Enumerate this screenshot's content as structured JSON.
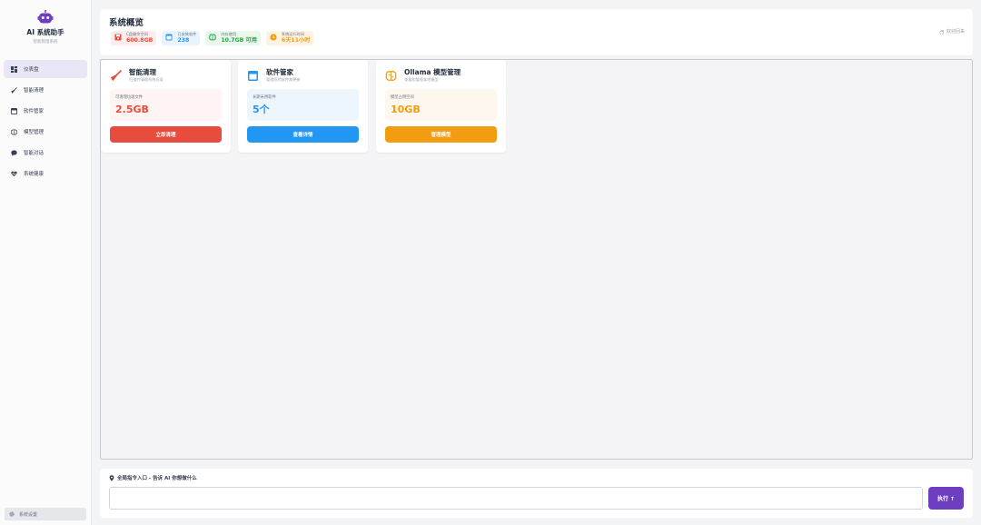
{
  "brand": {
    "title": "AI 系统助手",
    "subtitle": "智能管理系统"
  },
  "sidebar": {
    "items": [
      {
        "label": "仪表盘",
        "icon": "dashboard-icon",
        "active": true
      },
      {
        "label": "智能清理",
        "icon": "broom-icon",
        "active": false
      },
      {
        "label": "软件管家",
        "icon": "software-icon",
        "active": false
      },
      {
        "label": "模型管理",
        "icon": "brain-icon",
        "active": false
      },
      {
        "label": "智能对话",
        "icon": "chat-icon",
        "active": false
      },
      {
        "label": "系统健康",
        "icon": "heartbeat-icon",
        "active": false
      }
    ],
    "settings_label": "系统设置"
  },
  "header": {
    "title": "系统概览",
    "welcome": "欢迎回来",
    "stats": [
      {
        "label": "C盘剩余空间",
        "value": "600.8GB",
        "color": "#e74c3c",
        "bg": "#fdecec",
        "icon": "disk-icon"
      },
      {
        "label": "已安装软件",
        "value": "238",
        "color": "#2196f3",
        "bg": "#e8f3fd",
        "icon": "apps-icon"
      },
      {
        "label": "内存使用",
        "value": "10.7GB 可用",
        "color": "#22a745",
        "bg": "#e9f7ec",
        "icon": "memory-icon"
      },
      {
        "label": "系统运行时间",
        "value": "6天11小时",
        "color": "#f39c12",
        "bg": "#fdf3e3",
        "icon": "clock-icon"
      }
    ]
  },
  "cards": [
    {
      "title": "智能清理",
      "subtitle": "扫描并清理系统垃圾",
      "box_label": "可清理垃圾文件",
      "box_value": "2.5GB",
      "button": "立即清理",
      "color": "#e74c3c",
      "box_bg": "#fef4f3",
      "icon": "broom-icon"
    },
    {
      "title": "软件管家",
      "subtitle": "管理您的软件和更新",
      "box_label": "长期未用软件",
      "box_value": "5个",
      "button": "查看详情",
      "color": "#2196f3",
      "box_bg": "#eef6fd",
      "icon": "software-icon"
    },
    {
      "title": "Ollama 模型管理",
      "subtitle": "查看和管理本地模型",
      "box_label": "模型占用空间",
      "box_value": "10GB",
      "button": "管理模型",
      "color": "#f39c12",
      "box_bg": "#fef7ee",
      "icon": "brain-icon"
    }
  ],
  "command": {
    "title": "全局指令入口 - 告诉 AI 你想做什么",
    "input_value": "",
    "button": "执行 ↑",
    "accent": "#6d3fc0"
  }
}
